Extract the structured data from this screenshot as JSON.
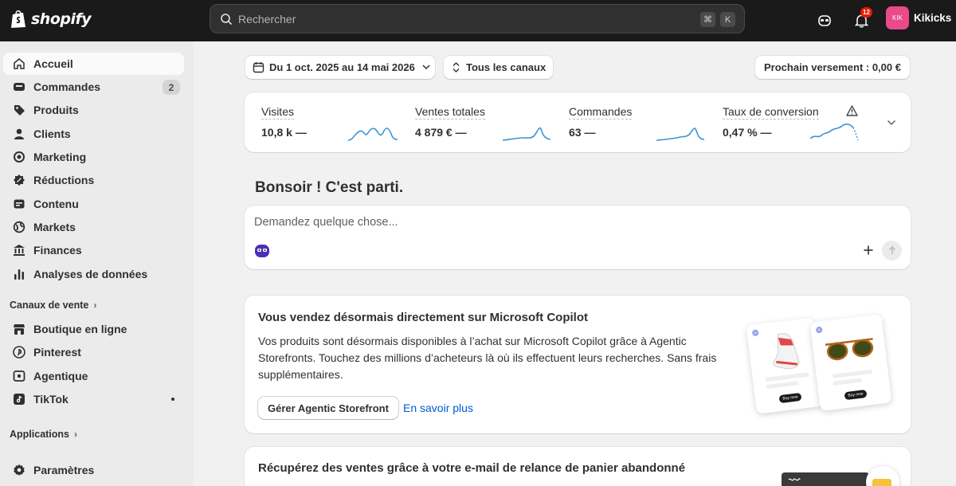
{
  "topbar": {
    "logo_text": "shopify",
    "search_placeholder": "Rechercher",
    "shortcut_keys": [
      "⌘",
      "K"
    ],
    "notification_count": "12",
    "store_initials": "KIK",
    "store_name": "Kikicks",
    "colors": {
      "bar": "#1a1a1a",
      "avatar": "#e94a8a",
      "badge": "#e51c00"
    }
  },
  "sidebar": {
    "items": [
      {
        "label": "Accueil",
        "icon": "home-icon",
        "active": true
      },
      {
        "label": "Commandes",
        "icon": "inbox-icon",
        "count": "2"
      },
      {
        "label": "Produits",
        "icon": "tag-icon"
      },
      {
        "label": "Clients",
        "icon": "person-icon"
      },
      {
        "label": "Marketing",
        "icon": "target-icon"
      },
      {
        "label": "Réductions",
        "icon": "discount-icon"
      },
      {
        "label": "Contenu",
        "icon": "content-icon"
      },
      {
        "label": "Markets",
        "icon": "globe-icon"
      },
      {
        "label": "Finances",
        "icon": "bank-icon"
      },
      {
        "label": "Analyses de données",
        "icon": "chart-bar-icon"
      }
    ],
    "sales_channels_label": "Canaux de vente",
    "sales_channels": [
      {
        "label": "Boutique en ligne",
        "icon": "store-icon"
      },
      {
        "label": "Pinterest",
        "icon": "pinterest-icon"
      },
      {
        "label": "Agentique",
        "icon": "agentic-icon"
      },
      {
        "label": "TikTok",
        "icon": "tiktok-icon",
        "dot": true
      }
    ],
    "apps_label": "Applications",
    "settings_label": "Paramètres"
  },
  "toolbar": {
    "date_range": "Du 1 oct. 2025 au 14 mai 2026",
    "channels": "Tous les canaux",
    "payout": "Prochain versement : 0,00 €"
  },
  "metrics": [
    {
      "label": "Visites",
      "value": "10,8 k",
      "trend": "—"
    },
    {
      "label": "Ventes totales",
      "value": "4 879 €",
      "trend": "—"
    },
    {
      "label": "Commandes",
      "value": "63",
      "trend": "—"
    },
    {
      "label": "Taux de conversion",
      "value": "0,47 %",
      "trend": "—",
      "warning": true
    }
  ],
  "greeting": "Bonsoir ! C'est parti.",
  "assistant": {
    "placeholder": "Demandez quelque chose..."
  },
  "promo_copilot": {
    "title": "Vous vendez désormais directement sur Microsoft Copilot",
    "text": "Vos produits sont désormais disponibles à l’achat sur Microsoft Copilot grâce à Agentic Storefronts. Touchez des millions d’acheteurs là où ils effectuent leurs recherches. Sans frais supplémentaires.",
    "button": "Gérer Agentic Storefront",
    "link": "En savoir plus",
    "illustration_button": "Buy now"
  },
  "promo_cart": {
    "title": "Récupérez des ventes grâce à votre e-mail de relance de panier abandonné"
  }
}
